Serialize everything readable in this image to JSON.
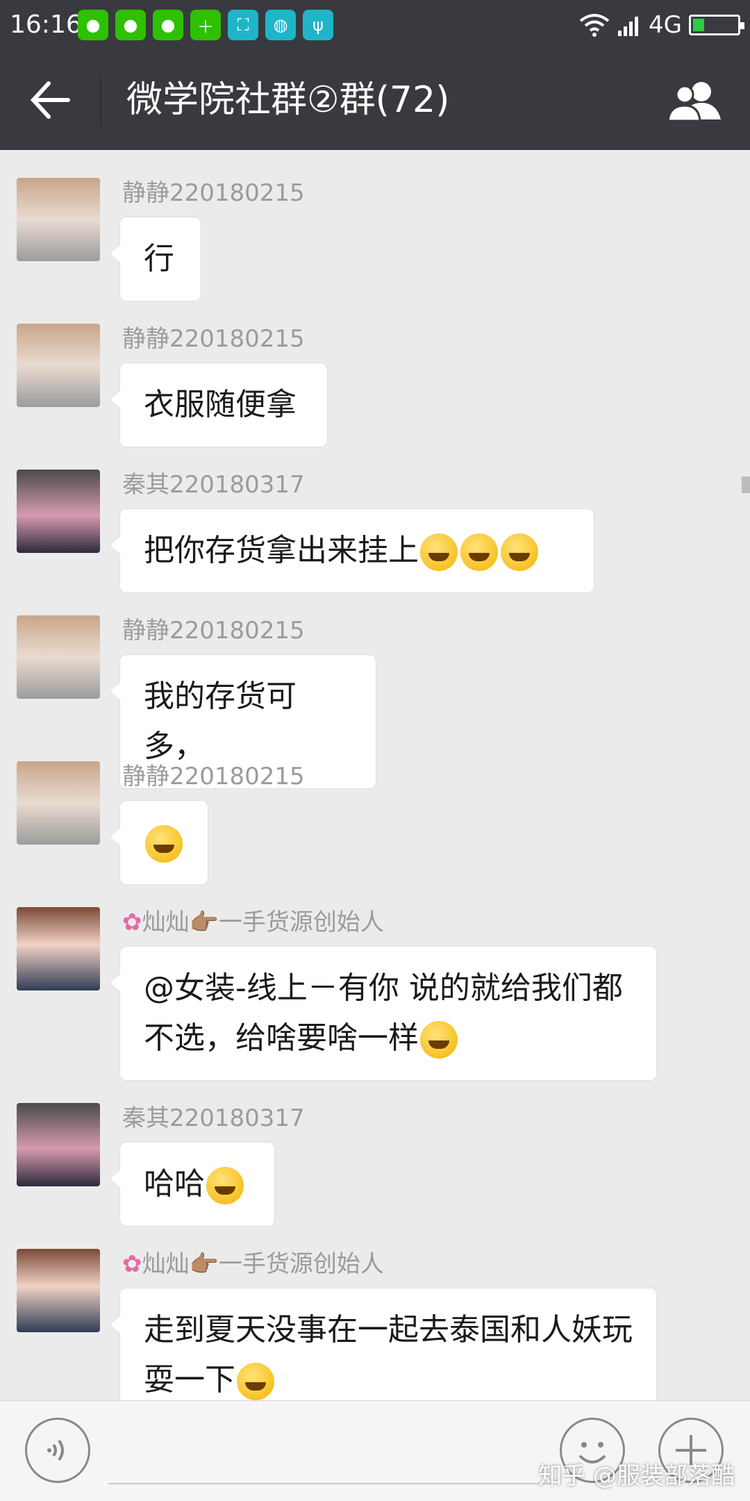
{
  "status_bar": {
    "time": "16:16",
    "network": "4G",
    "battery_level": 0.25,
    "notification_icons": [
      "wechat-icon",
      "wechat-icon",
      "wechat-icon",
      "plus-app-icon",
      "scan-icon",
      "basketball-icon",
      "usb-icon"
    ]
  },
  "header": {
    "title": "微学院社群②群(72)"
  },
  "messages": [
    {
      "sender": "静静220180215",
      "text": "行",
      "emojis": 0
    },
    {
      "sender": "静静220180215",
      "text": "衣服随便拿",
      "emojis": 0
    },
    {
      "sender": "秦其220180317",
      "text": "把你存货拿出来挂上",
      "emojis": 3
    },
    {
      "sender": "静静220180215",
      "text": "我的存货可多，",
      "emojis": 0
    },
    {
      "sender": "静静220180215",
      "text": "",
      "emojis": 1
    },
    {
      "sender": "灿灿👉🏽一手货源创始人",
      "text": "@女装-线上－有你  说的就给我们都不选，给啥要啥一样",
      "emojis": 1
    },
    {
      "sender": "秦其220180317",
      "text": "哈哈",
      "emojis": 1
    },
    {
      "sender": "灿灿👉🏽一手货源创始人",
      "text": "走到夏天没事在一起去泰国和人妖玩耍一下",
      "emojis": 1
    }
  ],
  "watermark": "知乎 @服装部落酷",
  "colors": {
    "header_bg": "#393a3f",
    "chat_bg": "#ebebeb",
    "bubble_bg": "#ffffff"
  }
}
